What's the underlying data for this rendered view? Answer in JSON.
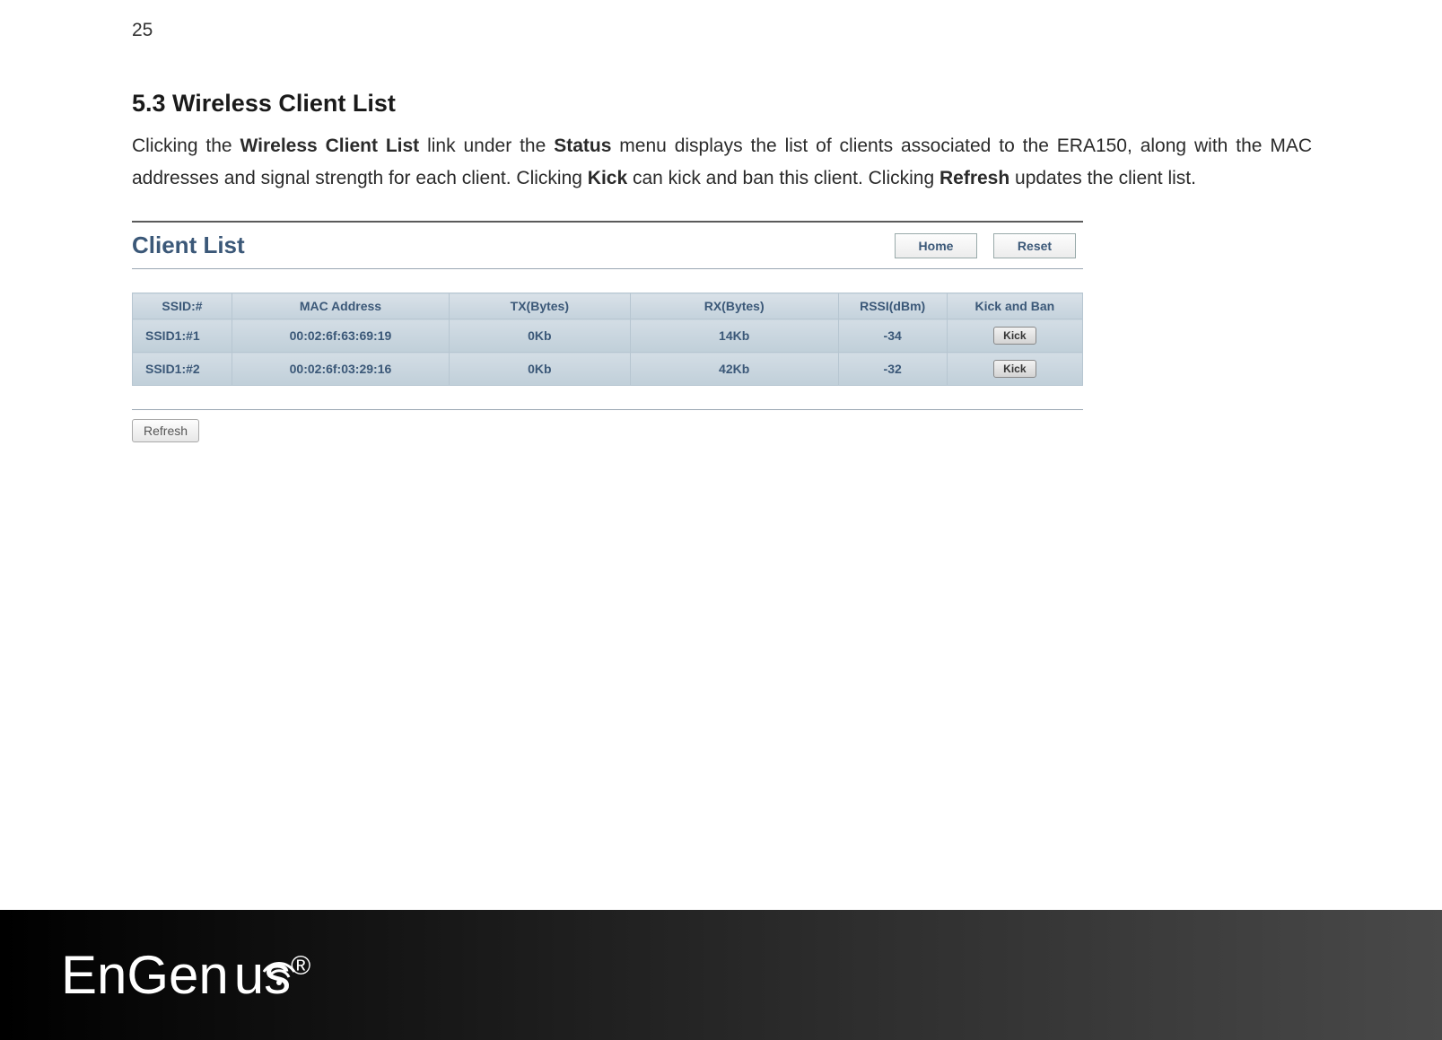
{
  "page_number": "25",
  "section": {
    "heading": "5.3   Wireless Client List",
    "paragraph_parts": {
      "p1": "Clicking the ",
      "b1": "Wireless Client List",
      "p2": " link under the ",
      "b2": "Status",
      "p3": " menu displays the list of clients associated to the ERA150, along with the MAC addresses and signal strength for each client. Clicking ",
      "b3": "Kick",
      "p4": " can kick and ban this client. Clicking ",
      "b4": "Refresh",
      "p5": " updates the client list."
    }
  },
  "ui": {
    "title": "Client List",
    "buttons": {
      "home": "Home",
      "reset": "Reset",
      "refresh": "Refresh",
      "kick": "Kick"
    },
    "columns": {
      "ssid": "SSID:#",
      "mac": "MAC Address",
      "tx": "TX(Bytes)",
      "rx": "RX(Bytes)",
      "rssi": "RSSI(dBm)",
      "kick": "Kick and Ban"
    },
    "rows": [
      {
        "ssid": "SSID1:#1",
        "mac": "00:02:6f:63:69:19",
        "tx": "0Kb",
        "rx": "14Kb",
        "rssi": "-34"
      },
      {
        "ssid": "SSID1:#2",
        "mac": "00:02:6f:03:29:16",
        "tx": "0Kb",
        "rx": "42Kb",
        "rssi": "-32"
      }
    ]
  },
  "footer": {
    "brand": "EnGen",
    "brand2": "us",
    "reg": "®"
  }
}
